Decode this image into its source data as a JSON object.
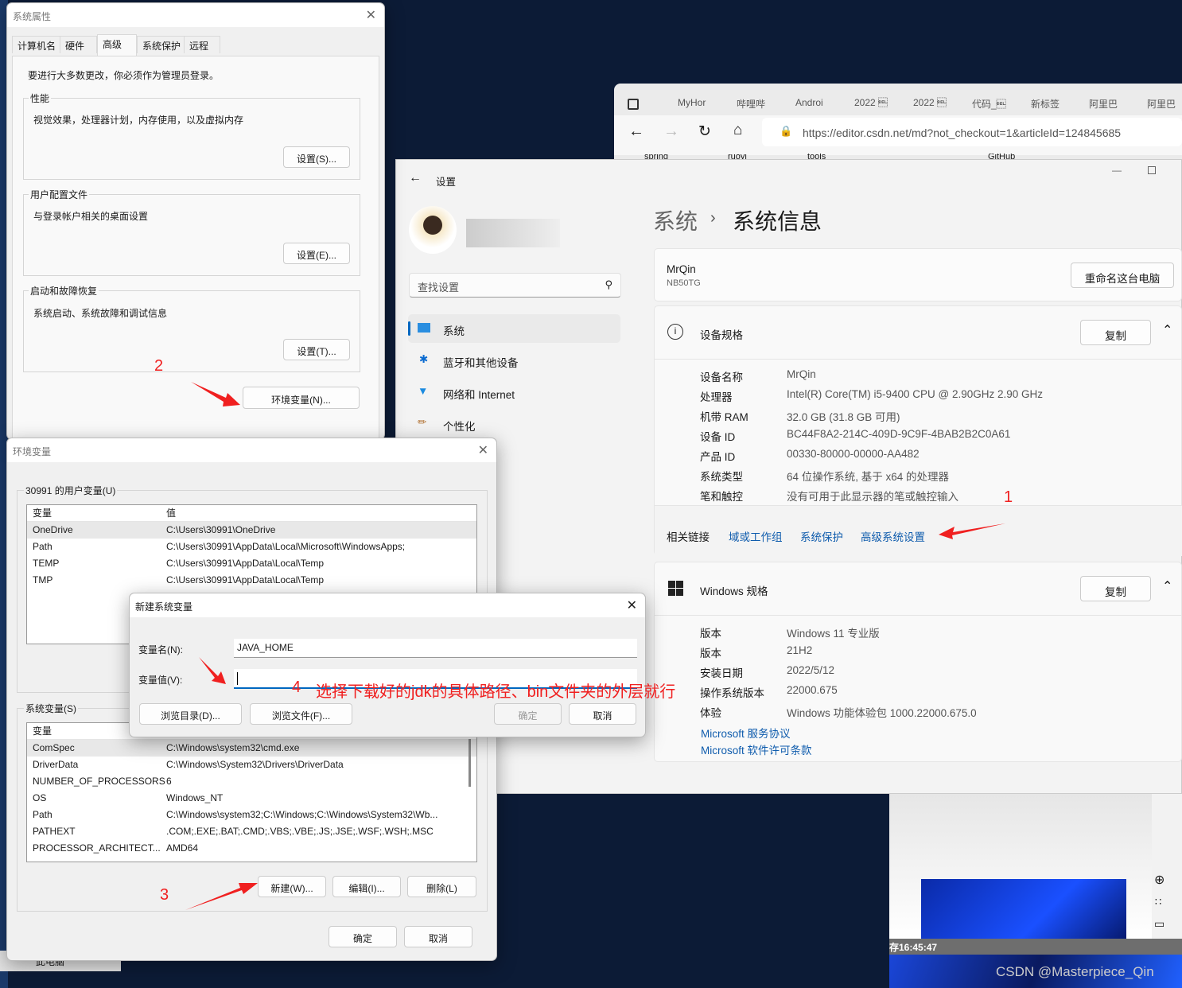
{
  "browser": {
    "tabs": [
      "MyHor",
      "哔哩哔",
      "Androi",
      "2022 \u0007",
      "2022 \u0007",
      "代码_\u0007",
      "新标签",
      "阿里巴",
      "阿里巴"
    ],
    "url": "https://editor.csdn.net/md?not_checkout=1&articleId=124845685",
    "bookmarks": [
      "spring",
      "ruoyi",
      "tools",
      "GitHub"
    ],
    "status": "存16:45:47",
    "watermark": "CSDN @Masterpiece_Qin"
  },
  "settings": {
    "title": "设置",
    "search_placeholder": "查找设置",
    "nav": [
      {
        "label": "系统",
        "icon": "monitor-icon"
      },
      {
        "label": "蓝牙和其他设备",
        "icon": "bluetooth-icon"
      },
      {
        "label": "网络和 Internet",
        "icon": "wifi-icon"
      },
      {
        "label": "个性化",
        "icon": "brush-icon"
      }
    ],
    "breadcrumb_parent": "系统",
    "page_title": "系统信息",
    "pc_name": "MrQin",
    "pc_model": "NB50TG",
    "rename_button": "重命名这台电脑",
    "device_spec": {
      "title": "设备规格",
      "copy": "复制",
      "rows": [
        [
          "设备名称",
          "MrQin"
        ],
        [
          "处理器",
          "Intel(R) Core(TM) i5-9400 CPU @ 2.90GHz   2.90 GHz"
        ],
        [
          "机带 RAM",
          "32.0 GB (31.8 GB 可用)"
        ],
        [
          "设备 ID",
          "BC44F8A2-214C-409D-9C9F-4BAB2B2C0A61"
        ],
        [
          "产品 ID",
          "00330-80000-00000-AA482"
        ],
        [
          "系统类型",
          "64 位操作系统, 基于 x64 的处理器"
        ],
        [
          "笔和触控",
          "没有可用于此显示器的笔或触控输入"
        ]
      ]
    },
    "related": {
      "label": "相关链接",
      "links": [
        "域或工作组",
        "系统保护",
        "高级系统设置"
      ]
    },
    "windows_spec": {
      "title": "Windows 规格",
      "copy": "复制",
      "rows": [
        [
          "版本",
          "Windows 11 专业版"
        ],
        [
          "版本",
          "21H2"
        ],
        [
          "安装日期",
          "2022/5/12"
        ],
        [
          "操作系统版本",
          "22000.675"
        ],
        [
          "体验",
          "Windows 功能体验包 1000.22000.675.0"
        ]
      ],
      "links": [
        "Microsoft 服务协议",
        "Microsoft 软件许可条款"
      ]
    }
  },
  "sysprops": {
    "title": "系统属性",
    "tabs": [
      "计算机名",
      "硬件",
      "高级",
      "系统保护",
      "远程"
    ],
    "active_tab": 2,
    "admin_note": "要进行大多数更改，你必须作为管理员登录。",
    "groups": [
      {
        "label": "性能",
        "desc": "视觉效果，处理器计划，内存使用，以及虚拟内存",
        "button": "设置(S)..."
      },
      {
        "label": "用户配置文件",
        "desc": "与登录帐户相关的桌面设置",
        "button": "设置(E)..."
      },
      {
        "label": "启动和故障恢复",
        "desc": "系统启动、系统故障和调试信息",
        "button": "设置(T)..."
      }
    ],
    "env_button": "环境变量(N)..."
  },
  "envvars": {
    "title": "环境变量",
    "user_label": "30991 的用户变量(U)",
    "col_var": "变量",
    "col_val": "值",
    "user_rows": [
      [
        "OneDrive",
        "C:\\Users\\30991\\OneDrive"
      ],
      [
        "Path",
        "C:\\Users\\30991\\AppData\\Local\\Microsoft\\WindowsApps;"
      ],
      [
        "TEMP",
        "C:\\Users\\30991\\AppData\\Local\\Temp"
      ],
      [
        "TMP",
        "C:\\Users\\30991\\AppData\\Local\\Temp"
      ]
    ],
    "sys_label": "系统变量(S)",
    "sys_rows": [
      [
        "ComSpec",
        "C:\\Windows\\system32\\cmd.exe"
      ],
      [
        "DriverData",
        "C:\\Windows\\System32\\Drivers\\DriverData"
      ],
      [
        "NUMBER_OF_PROCESSORS",
        "6"
      ],
      [
        "OS",
        "Windows_NT"
      ],
      [
        "Path",
        "C:\\Windows\\system32;C:\\Windows;C:\\Windows\\System32\\Wb..."
      ],
      [
        "PATHEXT",
        ".COM;.EXE;.BAT;.CMD;.VBS;.VBE;.JS;.JSE;.WSF;.WSH;.MSC"
      ],
      [
        "PROCESSOR_ARCHITECT...",
        "AMD64"
      ]
    ],
    "new": "新建(W)...",
    "edit": "编辑(I)...",
    "delete": "删除(L)",
    "ok": "确定",
    "cancel": "取消"
  },
  "newvar": {
    "title": "新建系统变量",
    "name_label": "变量名(N):",
    "name_value": "JAVA_HOME",
    "value_label": "变量值(V):",
    "value_value": "",
    "browse_dir": "浏览目录(D)...",
    "browse_file": "浏览文件(F)...",
    "ok": "确定",
    "cancel": "取消"
  },
  "annotations": {
    "n1": "1",
    "n2": "2",
    "n3": "3",
    "n4": "4",
    "note": "选择下载好的jdk的具体路径、bin文件夹的外层就行"
  },
  "explorer": {
    "item": "此电脑"
  }
}
